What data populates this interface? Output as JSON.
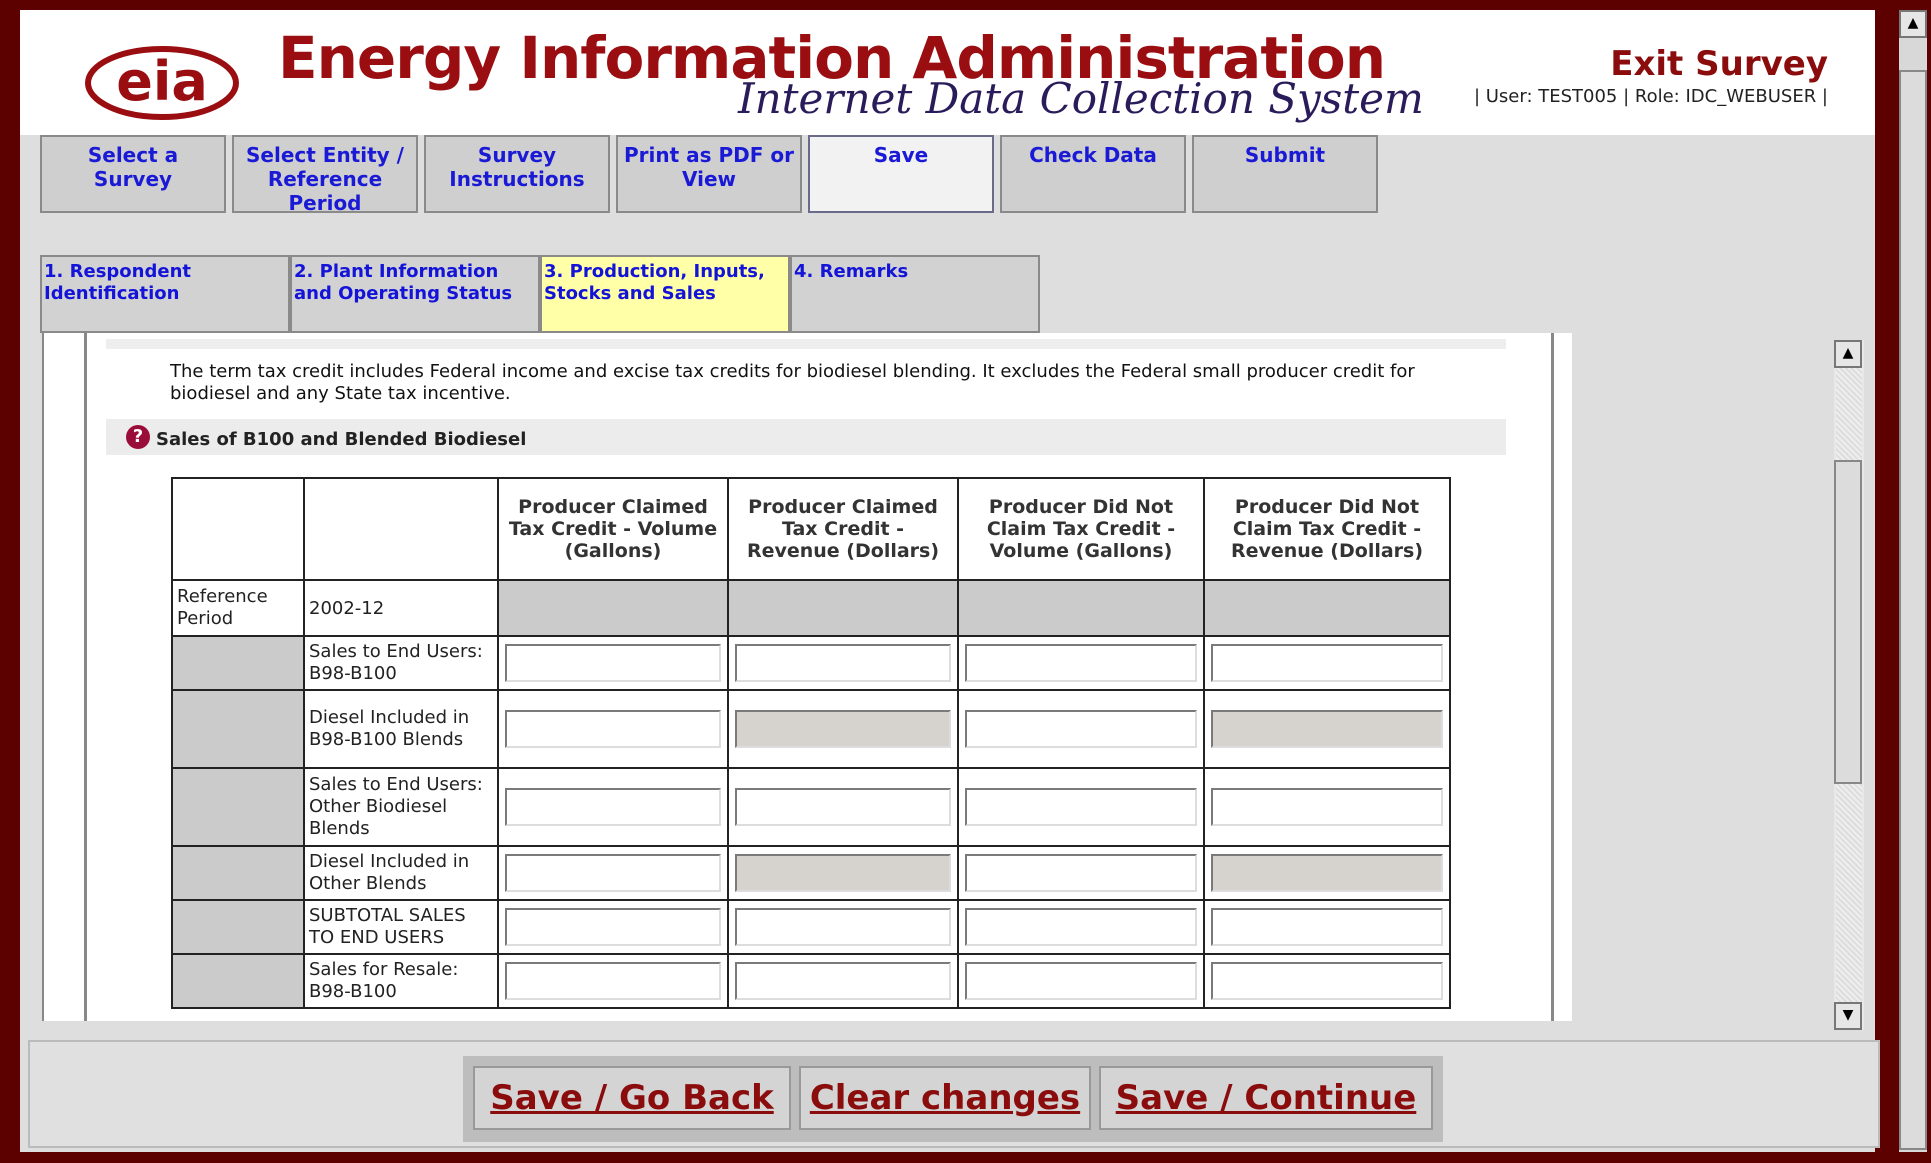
{
  "brand": {
    "logo_text": "eia",
    "title": "Energy Information Administration",
    "subtitle": "Internet Data Collection System",
    "exit_label": "Exit Survey",
    "user_line": "| User: TEST005 | Role: IDC_WEBUSER |"
  },
  "topnav": [
    {
      "label": "Select a\nSurvey"
    },
    {
      "label": "Select Entity /\nReference\nPeriod"
    },
    {
      "label": "Survey\nInstructions"
    },
    {
      "label": "Print as PDF or\nView"
    },
    {
      "label": "Save"
    },
    {
      "label": "Check Data"
    },
    {
      "label": "Submit"
    }
  ],
  "tabs": [
    {
      "label": "1. Respondent\nIdentification",
      "active": false
    },
    {
      "label": "2. Plant Information\nand Operating Status",
      "active": false
    },
    {
      "label": "3. Production, Inputs,\nStocks and Sales",
      "active": true
    },
    {
      "label": "4. Remarks",
      "active": false
    }
  ],
  "main": {
    "paragraph": "The term tax credit includes Federal income and excise tax credits for biodiesel blending. It excludes the Federal small producer credit for biodiesel and any State tax incentive.",
    "section_title": "Sales of B100 and Blended Biodiesel",
    "help_icon": "question-icon"
  },
  "table": {
    "columns": [
      "Producer Claimed Tax Credit - Volume (Gallons)",
      "Producer Claimed Tax Credit - Revenue (Dollars)",
      "Producer Did Not Claim Tax Credit - Volume (Gallons)",
      "Producer Did Not Claim Tax Credit - Revenue (Dollars)"
    ],
    "ref_label": "Reference Period",
    "ref_value": "2002-12",
    "rows": [
      {
        "label": "Sales to End Users: B98-B100",
        "disabled": [
          false,
          false,
          false,
          false
        ]
      },
      {
        "label": "Diesel Included in B98-B100 Blends",
        "disabled": [
          false,
          true,
          false,
          true
        ]
      },
      {
        "label": "Sales to End Users: Other Biodiesel Blends",
        "disabled": [
          false,
          false,
          false,
          false
        ]
      },
      {
        "label": "Diesel Included in Other Blends",
        "disabled": [
          false,
          true,
          false,
          true
        ]
      },
      {
        "label": "SUBTOTAL SALES TO END USERS",
        "disabled": [
          false,
          false,
          false,
          false
        ]
      },
      {
        "label": "Sales for Resale: B98-B100",
        "disabled": [
          false,
          false,
          false,
          false
        ]
      }
    ]
  },
  "footer": {
    "go_back": "Save / Go Back",
    "clear": "Clear changes",
    "continue": "Save / Continue"
  },
  "colors": {
    "frame": "#5c0000",
    "brand_red": "#9a0d10",
    "link_blue": "#1414d8",
    "active_tab": "#ffffa8"
  }
}
